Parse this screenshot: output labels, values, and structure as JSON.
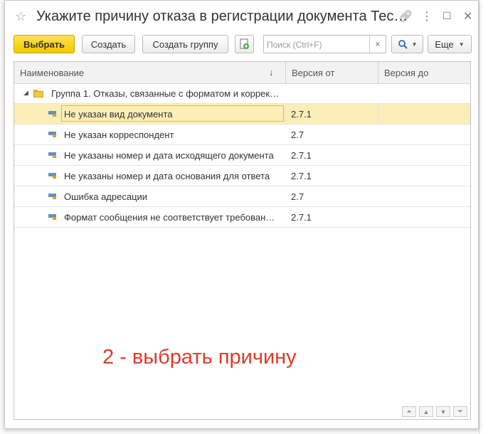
{
  "window": {
    "title": "Укажите причину отказа в регистрации документа Тес…"
  },
  "toolbar": {
    "select_label": "Выбрать",
    "create_label": "Создать",
    "create_group_label": "Создать группу",
    "search_placeholder": "Поиск (Ctrl+F)",
    "more_label": "Еще"
  },
  "columns": {
    "name": "Наименование",
    "version_from": "Версия от",
    "version_to": "Версия до"
  },
  "group": {
    "label": "Группа 1. Отказы, связанные с форматом и коррек…"
  },
  "rows": [
    {
      "name": "Не указан вид документа",
      "version_from": "2.7.1",
      "version_to": ""
    },
    {
      "name": "Не указан корреспондент",
      "version_from": "2.7",
      "version_to": ""
    },
    {
      "name": "Не указаны номер и дата исходящего документа",
      "version_from": "2.7.1",
      "version_to": ""
    },
    {
      "name": "Не указаны номер и дата основания для ответа",
      "version_from": "2.7.1",
      "version_to": ""
    },
    {
      "name": "Ошибка адресации",
      "version_from": "2.7",
      "version_to": ""
    },
    {
      "name": "Формат сообщения не соответствует требован…",
      "version_from": "2.7.1",
      "version_to": ""
    }
  ],
  "annotation": "2 - выбрать причину",
  "colors": {
    "accent": "#f5c700",
    "selected_row": "#fbeeb8",
    "annotation": "#e03b2a"
  }
}
